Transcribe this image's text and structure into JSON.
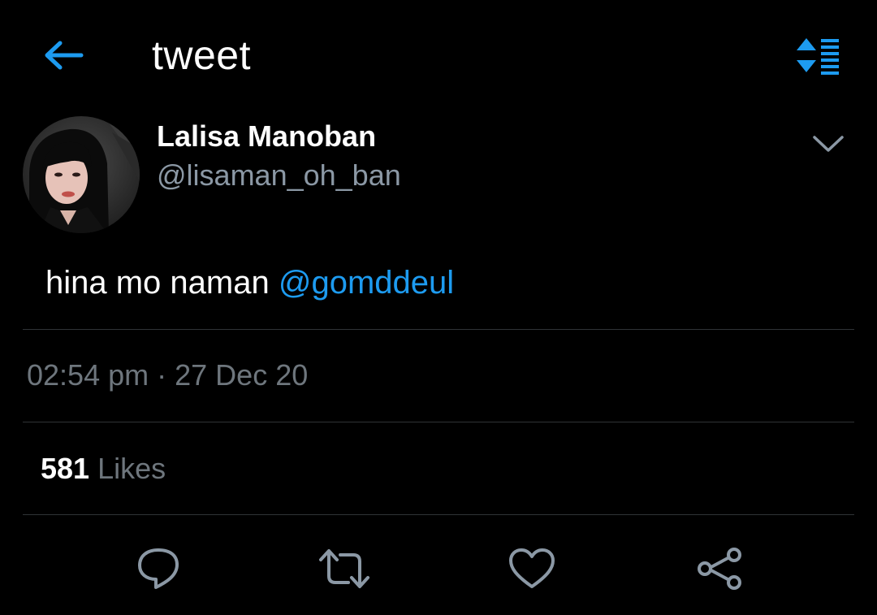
{
  "header": {
    "title": "tweet",
    "back_icon": "arrow-left-icon",
    "sort_icon": "sort-list-icon"
  },
  "tweet": {
    "author": {
      "display_name": "Lalisa Manoban",
      "handle": "@lisaman_oh_ban",
      "avatar": "profile-photo"
    },
    "text": "hina mo naman",
    "mention": "@gomddeul",
    "time": "02:54 pm",
    "separator": "·",
    "date": "27 Dec 20",
    "likes_count": "581",
    "likes_label": "Likes"
  },
  "actions": [
    {
      "name": "reply",
      "icon": "speech-bubble-icon"
    },
    {
      "name": "retweet",
      "icon": "retweet-icon"
    },
    {
      "name": "like",
      "icon": "heart-icon"
    },
    {
      "name": "share",
      "icon": "share-nodes-icon"
    }
  ],
  "colors": {
    "background": "#000000",
    "accent": "#1d9bf0",
    "secondary_text": "#8b98a5",
    "muted_text": "#6e767d",
    "divider": "#2f3336",
    "icon": "#8b98a5"
  }
}
